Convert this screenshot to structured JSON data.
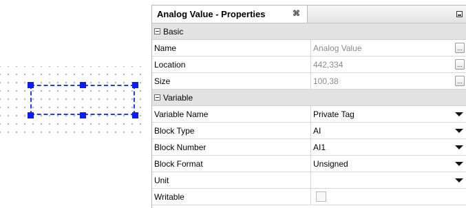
{
  "panel": {
    "title": "Analog Value - Properties",
    "close_glyph": "⌘",
    "minimize_icon": "minimize-icon"
  },
  "categories": {
    "basic": {
      "label": "Basic",
      "toggle": "−"
    },
    "variable": {
      "label": "Variable",
      "toggle": "−"
    }
  },
  "properties": {
    "name": {
      "label": "Name",
      "value": "Analog Value"
    },
    "location": {
      "label": "Location",
      "value": "442,334"
    },
    "size": {
      "label": "Size",
      "value": "100,38"
    },
    "variable_name": {
      "label": "Variable Name",
      "value": "Private Tag"
    },
    "block_type": {
      "label": "Block Type",
      "value": "AI"
    },
    "block_number": {
      "label": "Block Number",
      "value": "AI1"
    },
    "block_format": {
      "label": "Block Format",
      "value": "Unsigned"
    },
    "unit": {
      "label": "Unit",
      "value": ""
    },
    "writable": {
      "label": "Writable",
      "checked": false
    }
  },
  "ellipsis_label": "...",
  "colors": {
    "selection": "#1a3cff",
    "handle": "#0a1cf0",
    "category_bg": "#e2e2e2",
    "readonly_text": "#8a8a8a"
  }
}
